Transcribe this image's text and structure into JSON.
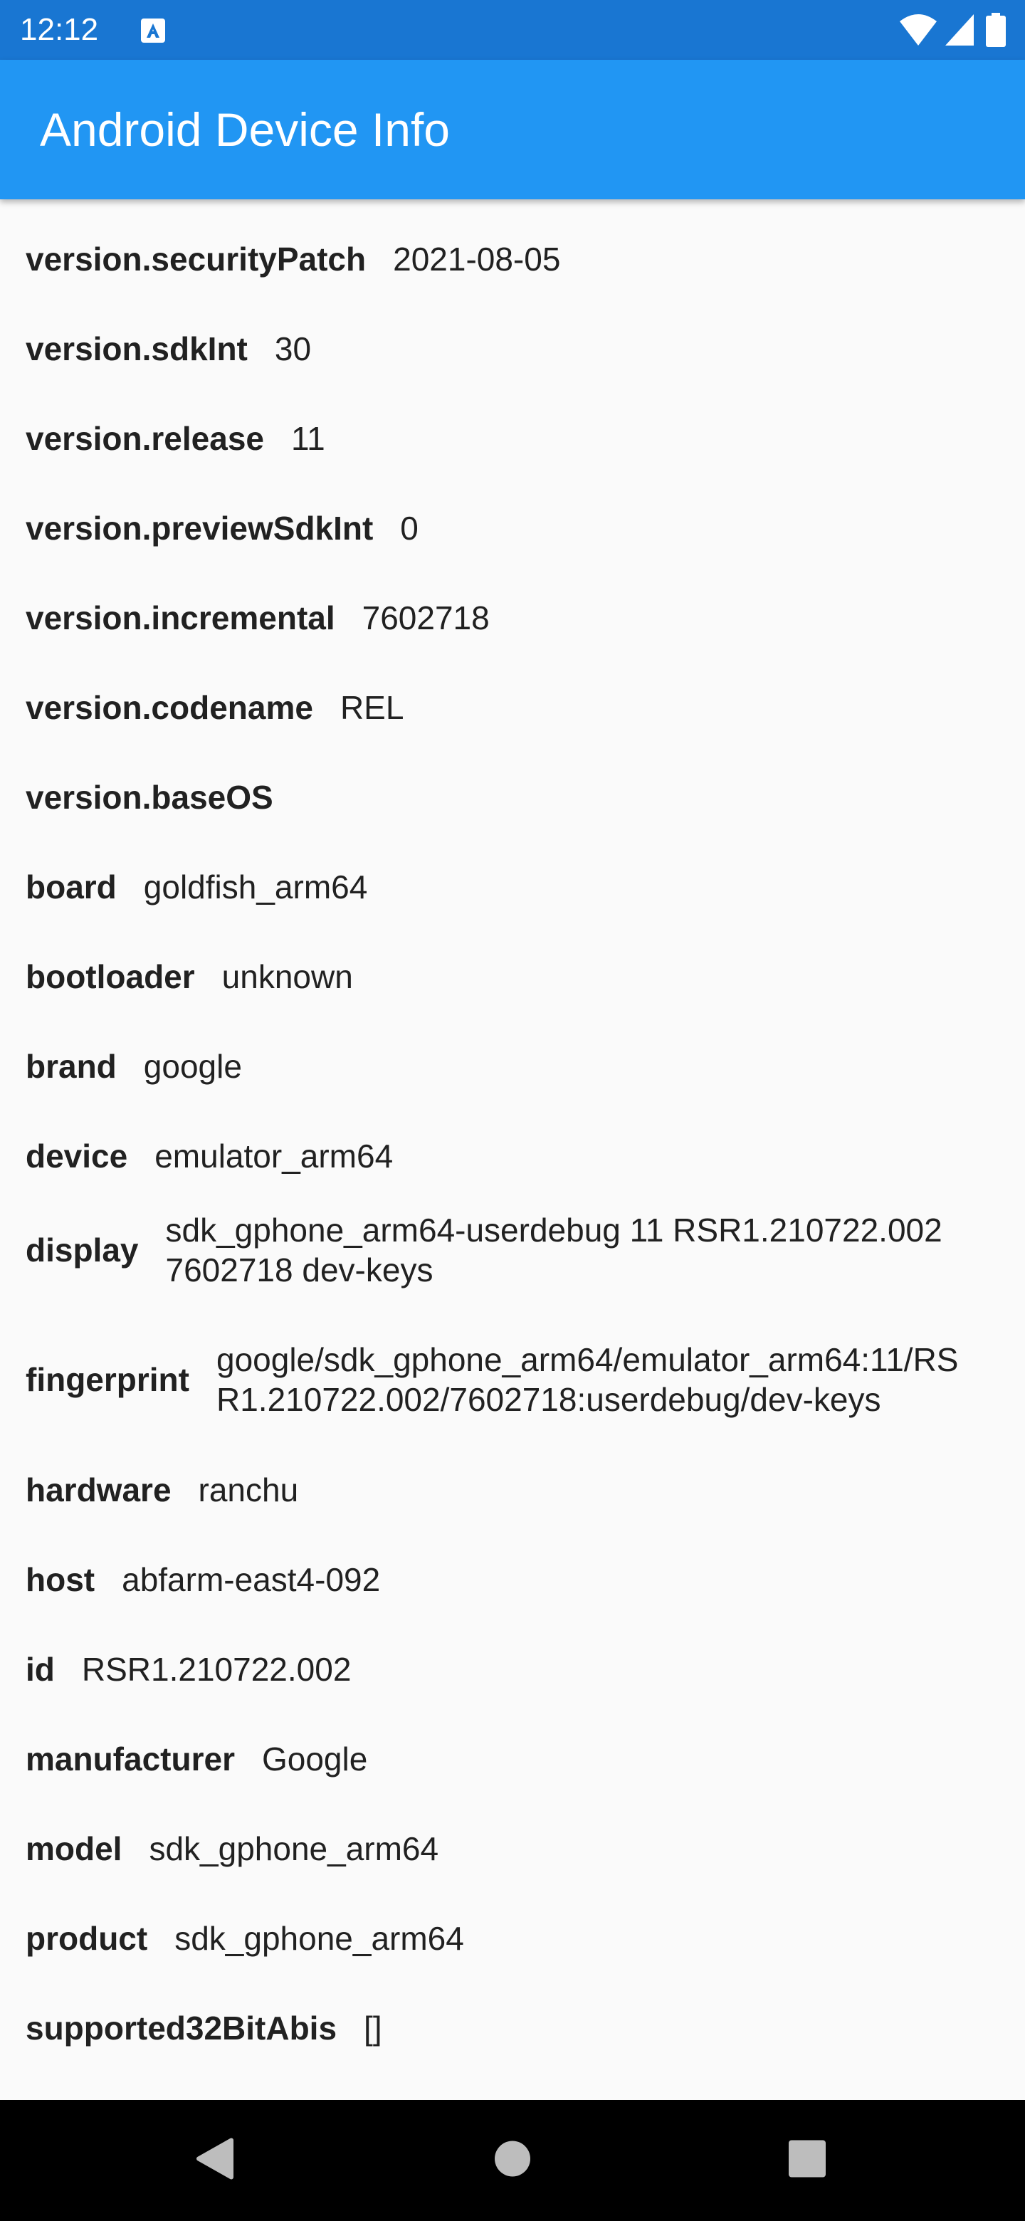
{
  "status_bar": {
    "time": "12:12",
    "icons": [
      "accessibility-a-icon",
      "wifi-icon",
      "cellular-signal-icon",
      "battery-icon"
    ]
  },
  "app_bar": {
    "title": "Android Device Info",
    "color": "#2196f3"
  },
  "rows": [
    {
      "key": "version.securityPatch",
      "value": "2021-08-05"
    },
    {
      "key": "version.sdkInt",
      "value": "30"
    },
    {
      "key": "version.release",
      "value": "11"
    },
    {
      "key": "version.previewSdkInt",
      "value": "0"
    },
    {
      "key": "version.incremental",
      "value": "7602718"
    },
    {
      "key": "version.codename",
      "value": "REL"
    },
    {
      "key": "version.baseOS",
      "value": ""
    },
    {
      "key": "board",
      "value": "goldfish_arm64"
    },
    {
      "key": "bootloader",
      "value": "unknown"
    },
    {
      "key": "brand",
      "value": "google"
    },
    {
      "key": "device",
      "value": "emulator_arm64"
    },
    {
      "key": "display",
      "value": "sdk_gphone_arm64-userdebug 11 RSR1.210722.002 7602718 dev-keys"
    },
    {
      "key": "fingerprint",
      "value": "google/sdk_gphone_arm64/emulator_arm64:11/RSR1.210722.002/7602718:userdebug/dev-keys"
    },
    {
      "key": "hardware",
      "value": "ranchu"
    },
    {
      "key": "host",
      "value": "abfarm-east4-092"
    },
    {
      "key": "id",
      "value": "RSR1.210722.002"
    },
    {
      "key": "manufacturer",
      "value": "Google"
    },
    {
      "key": "model",
      "value": "sdk_gphone_arm64"
    },
    {
      "key": "product",
      "value": "sdk_gphone_arm64"
    },
    {
      "key": "supported32BitAbis",
      "value": "[]"
    }
  ],
  "nav_bar": {
    "buttons": [
      "back-icon",
      "home-icon",
      "recents-icon"
    ]
  }
}
